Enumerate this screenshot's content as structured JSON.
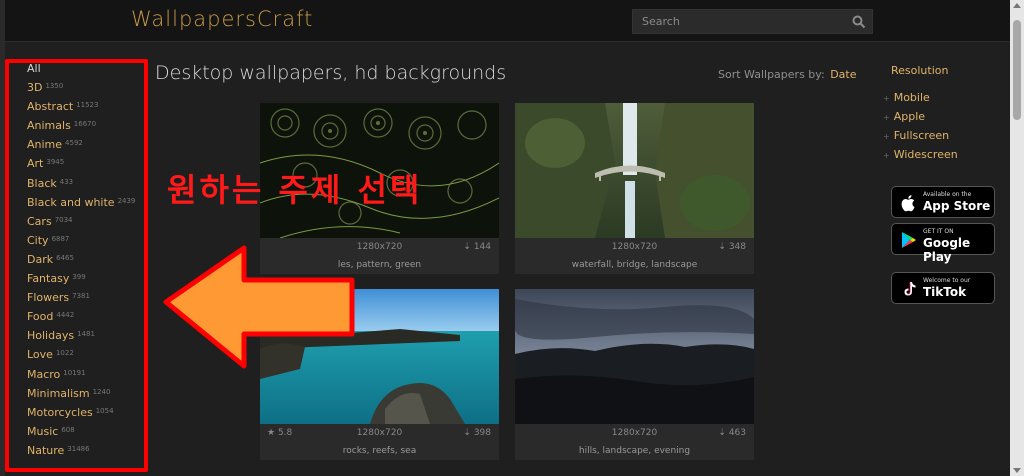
{
  "header": {
    "logo": "WallpapersCraft",
    "search_placeholder": "Search"
  },
  "page_title": "Desktop wallpapers, hd backgrounds",
  "sort": {
    "label": "Sort Wallpapers by:",
    "value": "Date"
  },
  "categories": {
    "all": "All",
    "items": [
      {
        "label": "3D",
        "count": "1350"
      },
      {
        "label": "Abstract",
        "count": "11523"
      },
      {
        "label": "Animals",
        "count": "16670"
      },
      {
        "label": "Anime",
        "count": "4592"
      },
      {
        "label": "Art",
        "count": "3945"
      },
      {
        "label": "Black",
        "count": "433"
      },
      {
        "label": "Black and white",
        "count": "2439"
      },
      {
        "label": "Cars",
        "count": "7034"
      },
      {
        "label": "City",
        "count": "6887"
      },
      {
        "label": "Dark",
        "count": "6465"
      },
      {
        "label": "Fantasy",
        "count": "399"
      },
      {
        "label": "Flowers",
        "count": "7381"
      },
      {
        "label": "Food",
        "count": "4442"
      },
      {
        "label": "Holidays",
        "count": "1481"
      },
      {
        "label": "Love",
        "count": "1022"
      },
      {
        "label": "Macro",
        "count": "10191"
      },
      {
        "label": "Minimalism",
        "count": "1240"
      },
      {
        "label": "Motorcycles",
        "count": "1054"
      },
      {
        "label": "Music",
        "count": "608"
      },
      {
        "label": "Nature",
        "count": "31486"
      }
    ]
  },
  "wallpapers": [
    {
      "resolution": "1280x720",
      "downloads": "144",
      "rating": "",
      "tags": "les, pattern, green"
    },
    {
      "resolution": "1280x720",
      "downloads": "348",
      "rating": "",
      "tags": "waterfall, bridge, landscape"
    },
    {
      "resolution": "1280x720",
      "downloads": "398",
      "rating": "5.8",
      "tags": "rocks, reefs, sea"
    },
    {
      "resolution": "1280x720",
      "downloads": "463",
      "rating": "",
      "tags": "hills, landscape, evening"
    }
  ],
  "resolution": {
    "title": "Resolution",
    "items": [
      "Mobile",
      "Apple",
      "Fullscreen",
      "Widescreen"
    ]
  },
  "badges": {
    "appstore": {
      "small": "Available on the",
      "big": "App Store"
    },
    "googleplay": {
      "small": "GET IT ON",
      "big": "Google Play"
    },
    "tiktok": {
      "small": "Welcome to our",
      "big": "TikTok"
    }
  },
  "annotation": {
    "text": "원하는 주제 선택",
    "color": "#ff1a1a",
    "arrow_color": "#ff9933"
  },
  "colors": {
    "accent": "#e0b36a",
    "background": "#1f1f1f",
    "highlight_box": "#ff0000"
  }
}
